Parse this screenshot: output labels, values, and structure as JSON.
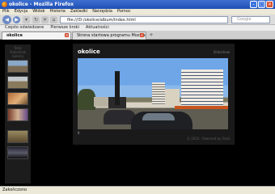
{
  "window": {
    "title": "okolice - Mozilla Firefox"
  },
  "menu": [
    "Plik",
    "Edycja",
    "Widok",
    "Historia",
    "Zakładki",
    "Narzędzia",
    "Pomoc"
  ],
  "address": {
    "url": "file:///D:/okolice/album/index.html"
  },
  "search": {
    "placeholder": "Google"
  },
  "bookmarks": [
    "Często odwiedzane",
    "Pierwsze kroki",
    "Aktualności"
  ],
  "tabs": [
    {
      "label": "okolice",
      "active": true
    },
    {
      "label": "Strona startowa programu Mozilla Firefox",
      "active": false
    }
  ],
  "sidebar": {
    "heading": "Total Slideshow Gallery"
  },
  "gallery": {
    "title": "okolice",
    "nav": "Slideshow",
    "counter": "6",
    "footer": "© 2010 · Powered by Total"
  },
  "status": {
    "text": "Zakończono"
  }
}
